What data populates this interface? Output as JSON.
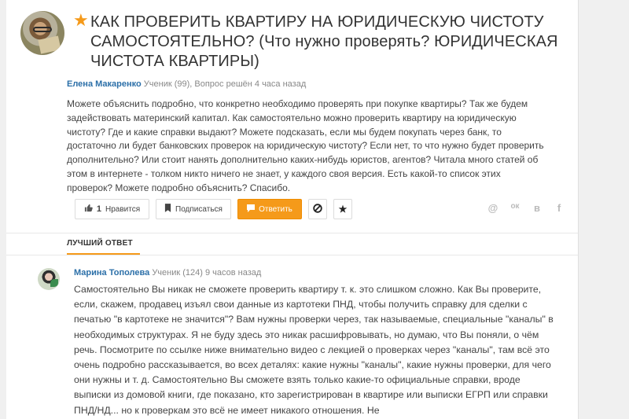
{
  "question": {
    "title": "КАК ПРОВЕРИТЬ КВАРТИРУ НА ЮРИДИЧЕСКУЮ ЧИСТОТУ САМОСТОЯТЕЛЬНО? (Что нужно проверять? ЮРИДИЧЕСКАЯ ЧИСТОТА КВАРТИРЫ)",
    "author_name": "Елена Макаренко",
    "author_meta": "Ученик (99), Вопрос решён 4 часа назад",
    "body": "Можете объяснить подробно, что конкретно необходимо проверять при покупке квартиры? Так же будем задействовать материнский капитал. Как самостоятельно можно проверить квартиру на юридическую чистоту? Где и какие справки выдают? Можете подсказать, если мы будем покупать через банк, то достаточно ли будет банковских проверок на юридическую чистоту? Если нет, то что нужно будет проверить дополнительно? Или стоит нанять дополнительно каких-нибудь юристов, агентов? Читала много статей об этом в интернете - толком никто ничего не знает, у каждого своя версия. Есть какой-то список этих проверок? Можете подробно объяснить? Спасибо."
  },
  "actions": {
    "like_count": "1",
    "like_label": "Нравится",
    "subscribe_label": "Подписаться",
    "answer_label": "Ответить"
  },
  "social": {
    "mail": "@",
    "ok": "ок",
    "vk": "в",
    "fb": "f"
  },
  "best_answer": {
    "label": "ЛУЧШИЙ ОТВЕТ",
    "author_name": "Марина Тополева",
    "author_meta": "Ученик (124) 9 часов назад",
    "body": "Самостоятельно Вы никак не сможете проверить квартиру т. к. это слишком сложно. Как Вы проверите, если, скажем, продавец изъял свои данные из картотеки ПНД, чтобы получить справку для сделки с печатью \"в картотеке не значится\"? Вам нужны проверки через, так называемые, специальные \"каналы\" в необходимых структурах. Я не буду здесь это никак расшифровывать, но думаю, что Вы поняли, о чём речь. Посмотрите по ссылке ниже внимательно видео с лекцией о проверках через \"каналы\", там всё это очень подробно рассказывается, во всех деталях: какие нужны \"каналы\", какие нужны проверки, для чего они нужны и т. д. Самостоятельно Вы сможете взять только какие-то официальные справки, вроде выписки из домовой книги, где показано, кто зарегистрирован в квартире или выписки ЕГРП или справки ПНД/НД... но к проверкам это всё не имеет никакого отношения. Не"
  },
  "colors": {
    "accent": "#f59a1a",
    "link": "#2b6fa8"
  },
  "icons": {
    "favorite": "star-icon",
    "like": "thumbs-up-icon",
    "subscribe": "bookmark-icon",
    "answer": "comment-icon",
    "block": "block-icon",
    "star_button": "star-icon"
  }
}
